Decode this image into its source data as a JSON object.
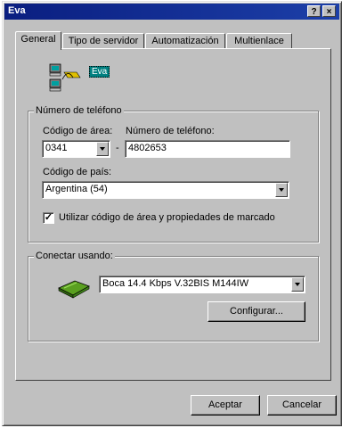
{
  "window": {
    "title": "Eva",
    "help_label": "?",
    "close_label": "×"
  },
  "tabs": [
    {
      "label": "General",
      "active": true
    },
    {
      "label": "Tipo de servidor",
      "active": false
    },
    {
      "label": "Automatización",
      "active": false
    },
    {
      "label": "Multienlace",
      "active": false
    }
  ],
  "connection": {
    "icon": "dialup-connection-icon",
    "name": "Eva"
  },
  "phone_group": {
    "legend": "Número de teléfono",
    "area_code_label": "Código de área:",
    "area_code_value": "0341",
    "separator": "-",
    "phone_label": "Número de teléfono:",
    "phone_value": "4802653",
    "country_label": "Código de país:",
    "country_value": "Argentina (54)",
    "use_area_code_label": "Utilizar código de área y propiedades de marcado",
    "use_area_code_checked": true,
    "check_mark": "✓"
  },
  "connect_group": {
    "legend": "Conectar usando:",
    "modem_icon": "modem-icon",
    "modem_value": "Boca 14.4 Kbps V.32BIS M144IW",
    "configure_label": "Configurar..."
  },
  "footer": {
    "accept_label": "Aceptar",
    "cancel_label": "Cancelar"
  }
}
